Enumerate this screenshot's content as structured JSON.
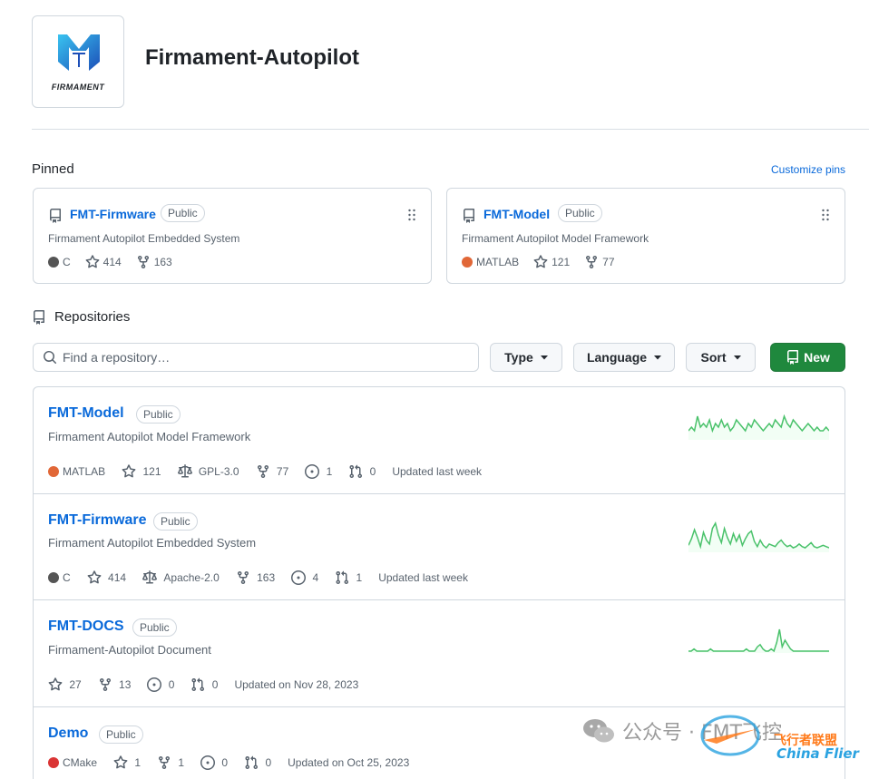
{
  "org": {
    "logo_text": "FIRMAMENT",
    "name": "Firmament-Autopilot"
  },
  "pinned": {
    "title": "Pinned",
    "customize_label": "Customize pins",
    "cards": [
      {
        "name": "FMT-Firmware",
        "visibility": "Public",
        "description": "Firmament Autopilot Embedded System",
        "language": "C",
        "language_color": "#555555",
        "stars": "414",
        "forks": "163"
      },
      {
        "name": "FMT-Model",
        "visibility": "Public",
        "description": "Firmament Autopilot Model Framework",
        "language": "MATLAB",
        "language_color": "#e16737",
        "stars": "121",
        "forks": "77"
      }
    ]
  },
  "repositories": {
    "title": "Repositories",
    "search_placeholder": "Find a repository…",
    "type_label": "Type",
    "language_label": "Language",
    "sort_label": "Sort",
    "new_label": "New",
    "items": [
      {
        "name": "FMT-Model",
        "visibility": "Public",
        "description": "Firmament Autopilot Model Framework",
        "language": "MATLAB",
        "language_color": "#e16737",
        "stars": "121",
        "license": "GPL-3.0",
        "forks": "77",
        "issues": "1",
        "pulls": "0",
        "updated": "Updated last week",
        "activity": [
          2,
          3,
          2,
          6,
          3,
          4,
          3,
          5,
          2,
          4,
          3,
          5,
          3,
          4,
          2,
          3,
          5,
          4,
          3,
          2,
          4,
          3,
          5,
          4,
          3,
          2,
          3,
          4,
          3,
          5,
          4,
          3,
          6,
          4,
          3,
          5,
          4,
          3,
          2,
          3,
          4,
          3,
          2,
          3,
          2,
          2,
          3,
          2
        ]
      },
      {
        "name": "FMT-Firmware",
        "visibility": "Public",
        "description": "Firmament Autopilot Embedded System",
        "language": "C",
        "language_color": "#555555",
        "stars": "414",
        "license": "Apache-2.0",
        "forks": "163",
        "issues": "4",
        "pulls": "1",
        "updated": "Updated last week",
        "activity": [
          4,
          9,
          16,
          10,
          3,
          14,
          8,
          5,
          17,
          21,
          12,
          6,
          17,
          10,
          5,
          13,
          7,
          12,
          4,
          9,
          13,
          15,
          7,
          3,
          8,
          4,
          2,
          5,
          4,
          3,
          6,
          8,
          5,
          3,
          4,
          2,
          3,
          5,
          3,
          2,
          4,
          6,
          3,
          2,
          3,
          4,
          3,
          2
        ]
      },
      {
        "name": "FMT-DOCS",
        "visibility": "Public",
        "description": "Firmament-Autopilot Document",
        "language": "",
        "language_color": "",
        "stars": "27",
        "license": "",
        "forks": "13",
        "issues": "0",
        "pulls": "0",
        "updated": "Updated on Nov 28, 2023",
        "activity": [
          0,
          0,
          1,
          0,
          0,
          0,
          0,
          0,
          1,
          0,
          0,
          0,
          0,
          0,
          0,
          0,
          0,
          0,
          0,
          0,
          0,
          1,
          0,
          0,
          0,
          2,
          3,
          1,
          0,
          0,
          1,
          0,
          4,
          10,
          2,
          5,
          3,
          1,
          0,
          0,
          0,
          0,
          0,
          0,
          0,
          0,
          0,
          0,
          0,
          0,
          0,
          0
        ]
      },
      {
        "name": "Demo",
        "visibility": "Public",
        "description": "",
        "language": "CMake",
        "language_color": "#da3434",
        "stars": "1",
        "license": "",
        "forks": "1",
        "issues": "0",
        "pulls": "0",
        "updated": "Updated on Oct 25, 2023",
        "activity": []
      }
    ]
  },
  "watermark": {
    "text": "公众号 · FMT飞控",
    "brand_cn": "飞行者联盟",
    "brand_en": "China Flier"
  },
  "colors": {
    "link": "#0969da",
    "new_button": "#1f883d",
    "spark": "#4ac26b"
  }
}
